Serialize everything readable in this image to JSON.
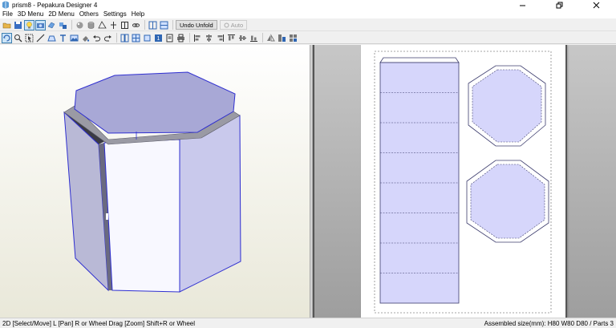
{
  "window": {
    "title": "prism8 - Pepakura Designer 4"
  },
  "menu": [
    {
      "label": "File"
    },
    {
      "label": "3D Menu"
    },
    {
      "label": "2D Menu"
    },
    {
      "label": "Others"
    },
    {
      "label": "Settings"
    },
    {
      "label": "Help"
    }
  ],
  "toolbar1": {
    "undo_unfold_label": "Undo Unfold",
    "auto_label": "Auto"
  },
  "statusbar": {
    "left": "2D [Select/Move] L [Pan] R or Wheel Drag [Zoom] Shift+R or Wheel",
    "right": "Assembled size(mm): H80 W80 D80 / Parts 3"
  },
  "icons": {
    "toolbar1": [
      "open-folder-icon",
      "save-icon",
      "lightbulb-icon",
      "camera-icon",
      "edit-3d-icon",
      "edit-parts-icon",
      "texture-icon",
      "cylinder-icon",
      "join-faces-icon",
      "pin-icon",
      "frame-icon",
      "link-icon",
      "layout-icon",
      "split-view-icon",
      "settings-icon"
    ],
    "toolbar2": [
      "rotate-icon",
      "zoom-icon",
      "select-icon",
      "draw-line-icon",
      "flap-icon",
      "text-icon",
      "image-icon",
      "paint-icon",
      "undo-icon",
      "redo-icon",
      "parts-grid-icon",
      "unfold-icon",
      "flaps-icon",
      "numbering-icon",
      "print-preview-icon",
      "print-icon",
      "align-left-icon",
      "align-center-icon",
      "align-right-icon",
      "align-top-icon",
      "align-middle-icon",
      "align-bottom-icon",
      "mirror-icon",
      "sort-icon",
      "arrange-icon"
    ]
  },
  "colors": {
    "part_fill": "#d6d6fb",
    "part_stroke": "#3d3d6e",
    "model_face": "#a8a8d6",
    "model_side": "#f6f6ff",
    "selection": "#2f2fd0"
  }
}
